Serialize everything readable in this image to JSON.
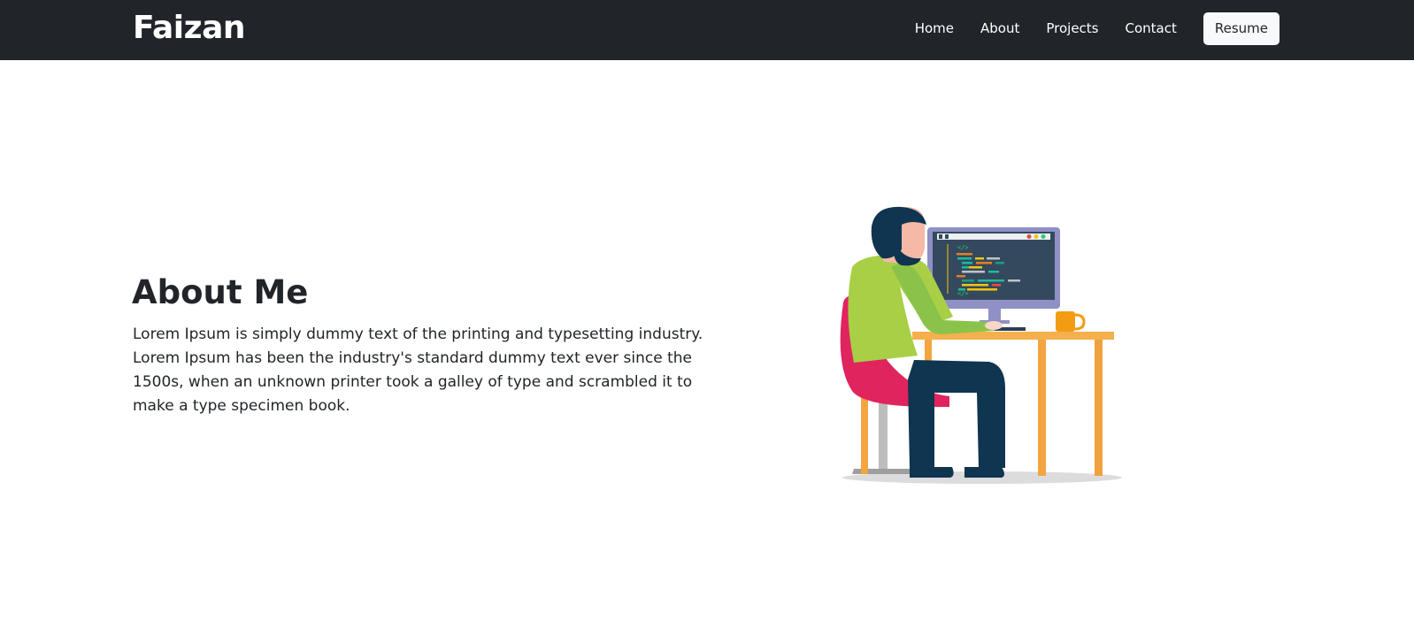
{
  "navbar": {
    "brand": "Faizan",
    "links": [
      {
        "label": "Home"
      },
      {
        "label": "About"
      },
      {
        "label": "Projects"
      },
      {
        "label": "Contact"
      }
    ],
    "resume_label": "Resume"
  },
  "about": {
    "title": "About Me",
    "text": "Lorem Ipsum is simply dummy text of the printing and typesetting industry. Lorem Ipsum has been the industry's standard dummy text ever since the 1500s, when an unknown printer took a galley of type and scrambled it to make a type specimen book."
  },
  "illustration": {
    "code_tag": "</>",
    "icon": "developer-at-desk-illustration"
  },
  "colors": {
    "navbar_bg": "#212529",
    "resume_bg": "#f8f9fa",
    "text": "#212529"
  }
}
